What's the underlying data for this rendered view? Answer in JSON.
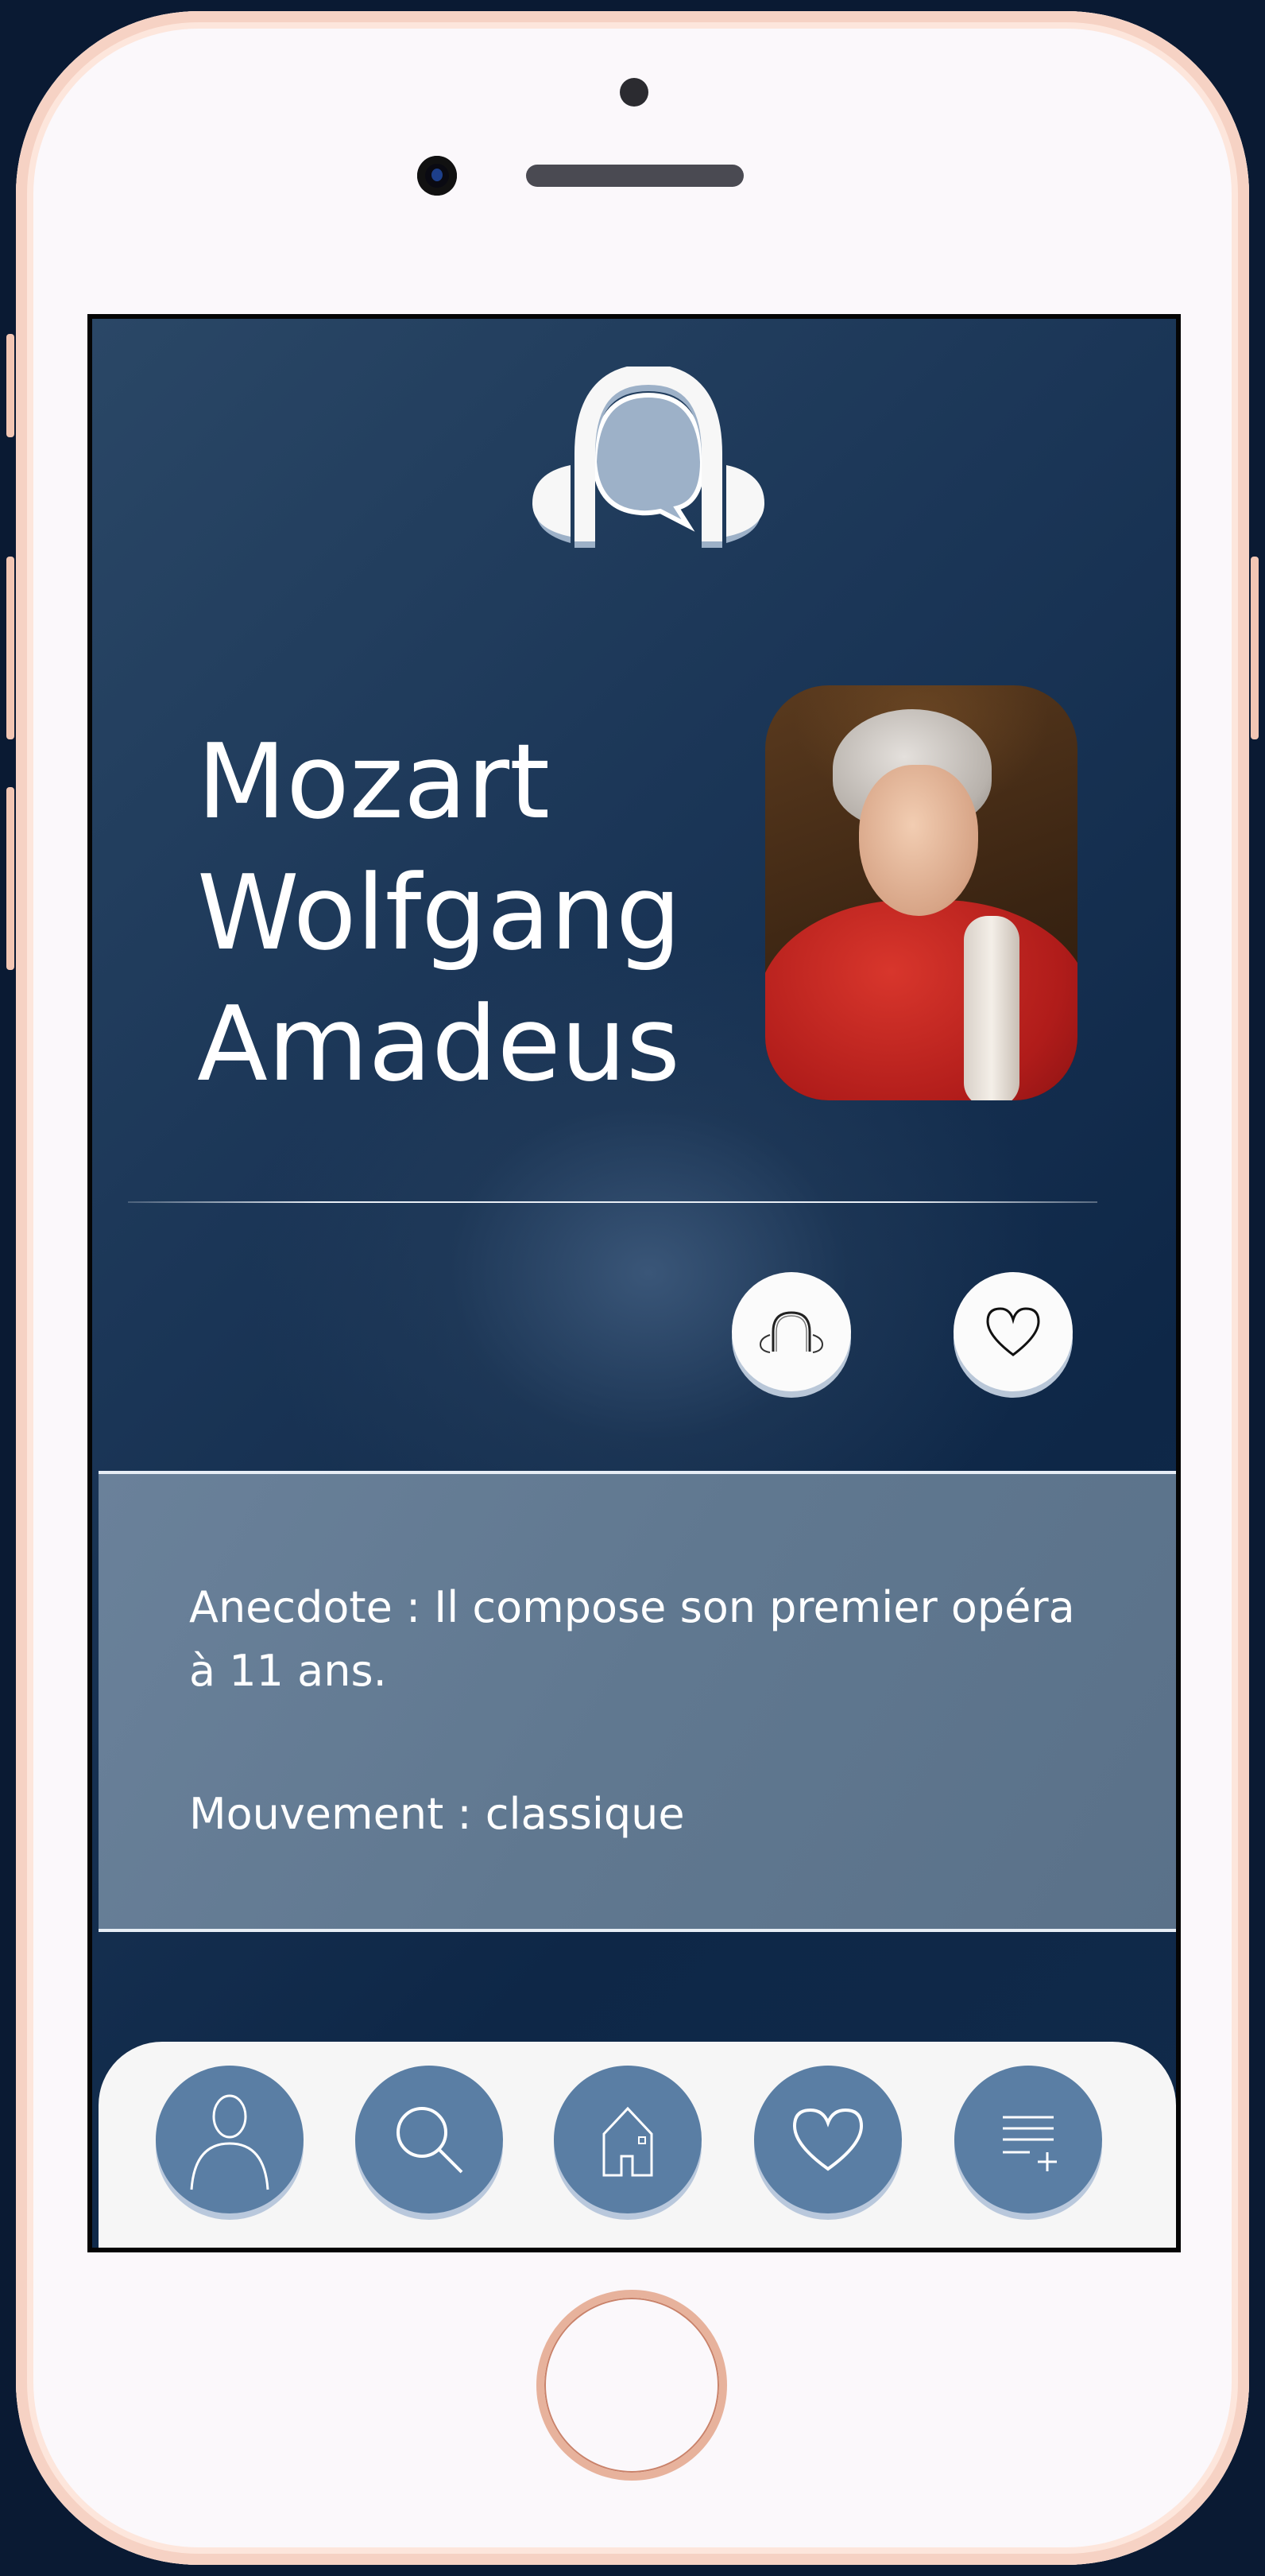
{
  "app": {
    "logo": "headphones-speech-bubble-logo"
  },
  "composer": {
    "name_lines": [
      "Mozart",
      "Wolfgang",
      "Amadeus"
    ],
    "portrait": "composer-portrait"
  },
  "actions": {
    "listen_icon": "headphones-icon",
    "favorite_icon": "heart-icon"
  },
  "info": {
    "anecdote": "Anecdote : Il compose son premier opéra à 11 ans.",
    "movement": "Mouvement : classique"
  },
  "nav": {
    "items": [
      {
        "icon": "user-icon"
      },
      {
        "icon": "search-icon"
      },
      {
        "icon": "home-icon"
      },
      {
        "icon": "heart-icon"
      },
      {
        "icon": "playlist-add-icon"
      }
    ]
  },
  "colors": {
    "background": "#0a1a33",
    "panel": "#637a93",
    "nav_button": "#5a7ea4",
    "frame": "#f6d2c4"
  }
}
